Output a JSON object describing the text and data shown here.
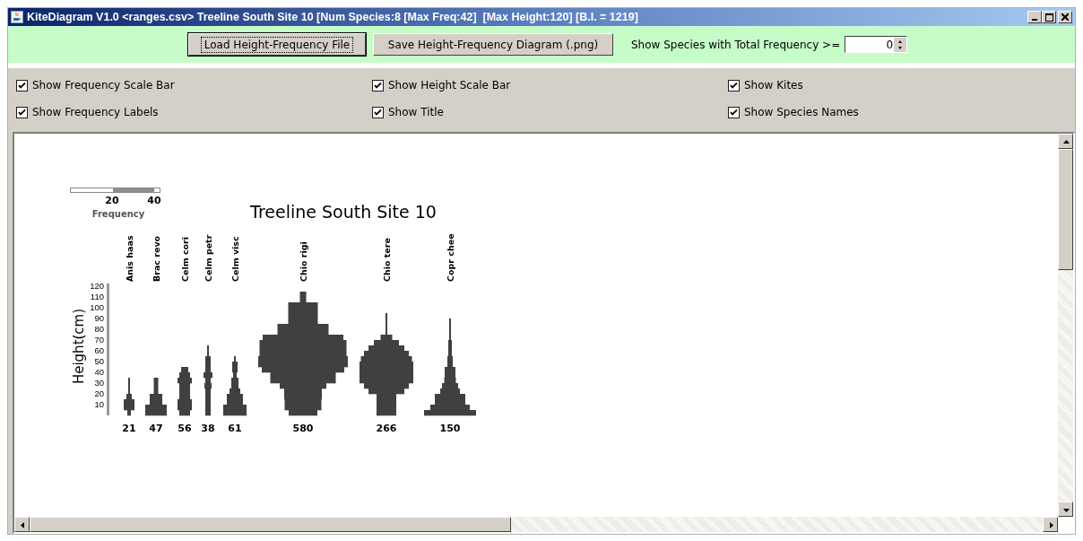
{
  "window": {
    "title": "KiteDiagram V1.0 <ranges.csv> Treeline South Site 10 [Num Species:8 [Max Freq:42]  [Max Height:120] [B.I. = 1219]"
  },
  "toolbar": {
    "buttons": [
      {
        "label": "Load Height-Frequency File",
        "focused": true
      },
      {
        "label": "Save Height-Frequency Diagram (.png)",
        "focused": false
      }
    ],
    "min_frequency": {
      "label": "Show Species with Total Frequency >=",
      "value": "0"
    }
  },
  "options": [
    {
      "label": "Show Frequency Scale Bar",
      "checked": true
    },
    {
      "label": "Show Height Scale Bar",
      "checked": true
    },
    {
      "label": "Show Kites",
      "checked": true
    },
    {
      "label": "Show Frequency Labels",
      "checked": true
    },
    {
      "label": "Show Title",
      "checked": true
    },
    {
      "label": "Show Species Names",
      "checked": true
    }
  ],
  "diagram": {
    "title": "Treeline South Site 10",
    "scale_bar": {
      "ticks": [
        "20",
        "40"
      ],
      "label": "Frequency"
    },
    "y_axis": {
      "label": "Height(cm)",
      "ticks": [
        "120",
        "110",
        "100",
        "90",
        "80",
        "70",
        "60",
        "50",
        "40",
        "30",
        "20",
        "10"
      ]
    },
    "species": [
      {
        "name": "Anis haas",
        "total": "21"
      },
      {
        "name": "Brac revo",
        "total": "47"
      },
      {
        "name": "Celm cori",
        "total": "56"
      },
      {
        "name": "Celm petr",
        "total": "38"
      },
      {
        "name": "Celm visc",
        "total": "61"
      },
      {
        "name": "Chio rigi",
        "total": "580"
      },
      {
        "name": "Chio tere",
        "total": "266"
      },
      {
        "name": "Copr chee",
        "total": "150"
      }
    ]
  }
}
